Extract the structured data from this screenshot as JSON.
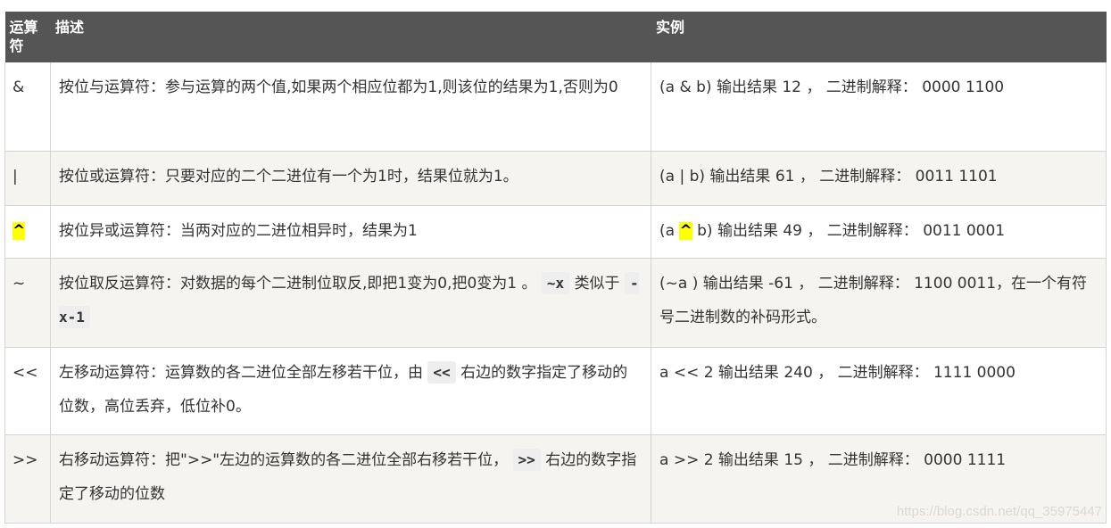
{
  "table": {
    "headers": [
      "运算符",
      "描述",
      "实例"
    ],
    "rows": [
      {
        "operator": "&",
        "description": "按位与运算符：参与运算的两个值,如果两个相应位都为1,则该位的结果为1,否则为0",
        "example": "(a & b) 输出结果 12 ， 二进制解释： 0000 1100"
      },
      {
        "operator": "|",
        "description": "按位或运算符：只要对应的二个二进位有一个为1时，结果位就为1。",
        "example": "(a | b) 输出结果 61 ， 二进制解释： 0011 1101"
      },
      {
        "operator": "^",
        "description": "按位异或运算符：当两对应的二进位相异时，结果为1",
        "example_before": "(a ",
        "example_op": "^",
        "example_after": " b) 输出结果 49 ， 二进制解释： 0011 0001"
      },
      {
        "operator": "~",
        "description_before": "按位取反运算符：对数据的每个二进制位取反,即把1变为0,把0变为1 。",
        "description_code1": "~x",
        "description_middle": "类似于",
        "description_code2": "-x-1",
        "example": "(~a ) 输出结果 -61 ， 二进制解释： 1100 0011，在一个有符号二进制数的补码形式。"
      },
      {
        "operator": "<<",
        "description_before": "左移动运算符：运算数的各二进位全部左移若干位，由",
        "description_code": "<<",
        "description_after": "右边的数字指定了移动的位数，高位丢弃，低位补0。",
        "example": "a << 2 输出结果 240 ， 二进制解释： 1111 0000"
      },
      {
        "operator": ">>",
        "description_before": "右移动运算符：把\">>\"左边的运算数的各二进位全部右移若干位，",
        "description_code": ">>",
        "description_after": "右边的数字指定了移动的位数",
        "example": "a >> 2 输出结果 15 ， 二进制解释： 0000 1111"
      }
    ]
  },
  "watermark": "https://blog.csdn.net/qq_35975447",
  "colors": {
    "header_bg": "#555555",
    "row_alt_bg": "#f6f4f0",
    "highlight": "#ffff00"
  }
}
